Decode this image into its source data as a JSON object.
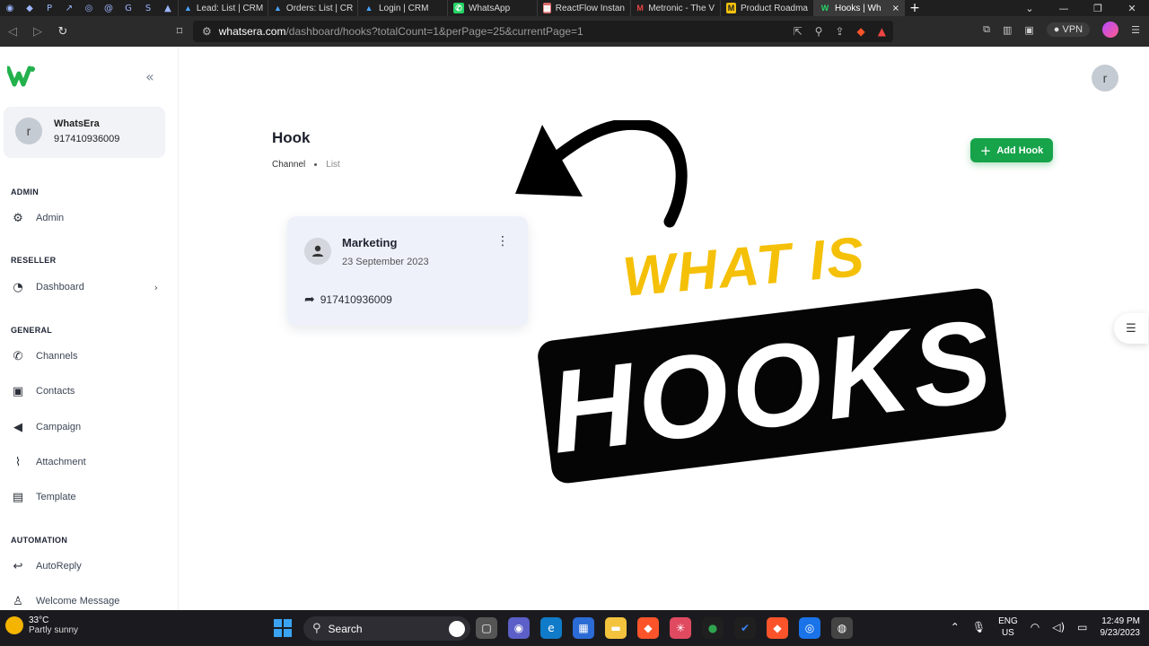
{
  "browser": {
    "tabs": [
      {
        "label": "Lead: List | CRM",
        "icon": "a"
      },
      {
        "label": "Orders: List | CR",
        "icon": "a"
      },
      {
        "label": "Login | CRM",
        "icon": "a"
      },
      {
        "label": "WhatsApp",
        "icon": "whatsapp"
      },
      {
        "label": "ReactFlow Instan",
        "icon": "grid"
      },
      {
        "label": "Metronic - The V",
        "icon": "m"
      },
      {
        "label": "Product Roadma",
        "icon": "m"
      },
      {
        "label": "Hooks | Wh",
        "icon": "w"
      }
    ],
    "url_host": "whatsera.com",
    "url_path": "/dashboard/hooks?totalCount=1&perPage=25&currentPage=1",
    "vpn_label": "VPN"
  },
  "sidebar": {
    "user_initial": "r",
    "user_name": "WhatsEra",
    "user_phone": "917410936009",
    "sections": {
      "admin": "ADMIN",
      "reseller": "RESELLER",
      "general": "GENERAL",
      "automation": "AUTOMATION"
    },
    "items": {
      "admin": "Admin",
      "dashboard": "Dashboard",
      "channels": "Channels",
      "contacts": "Contacts",
      "campaign": "Campaign",
      "attachment": "Attachment",
      "template": "Template",
      "autoreply": "AutoReply",
      "welcome": "Welcome Message"
    }
  },
  "main": {
    "avatar_initial": "r",
    "title": "Hook",
    "breadcrumb": [
      "Channel",
      "List"
    ],
    "add_button": "Add Hook",
    "card": {
      "name": "Marketing",
      "date": "23 September 2023",
      "number": "917410936009"
    },
    "overlay": {
      "what_is": "WHAT IS",
      "hooks": "HOOKS"
    }
  },
  "taskbar": {
    "temperature": "33°C",
    "weather": "Partly sunny",
    "search": "Search",
    "lang_top": "ENG",
    "lang_bottom": "US",
    "time": "12:49 PM",
    "date": "9/23/2023"
  },
  "colors": {
    "accent": "#16a34a",
    "overlay_yellow": "#f5c008",
    "card_bg": "#eef1fa"
  }
}
